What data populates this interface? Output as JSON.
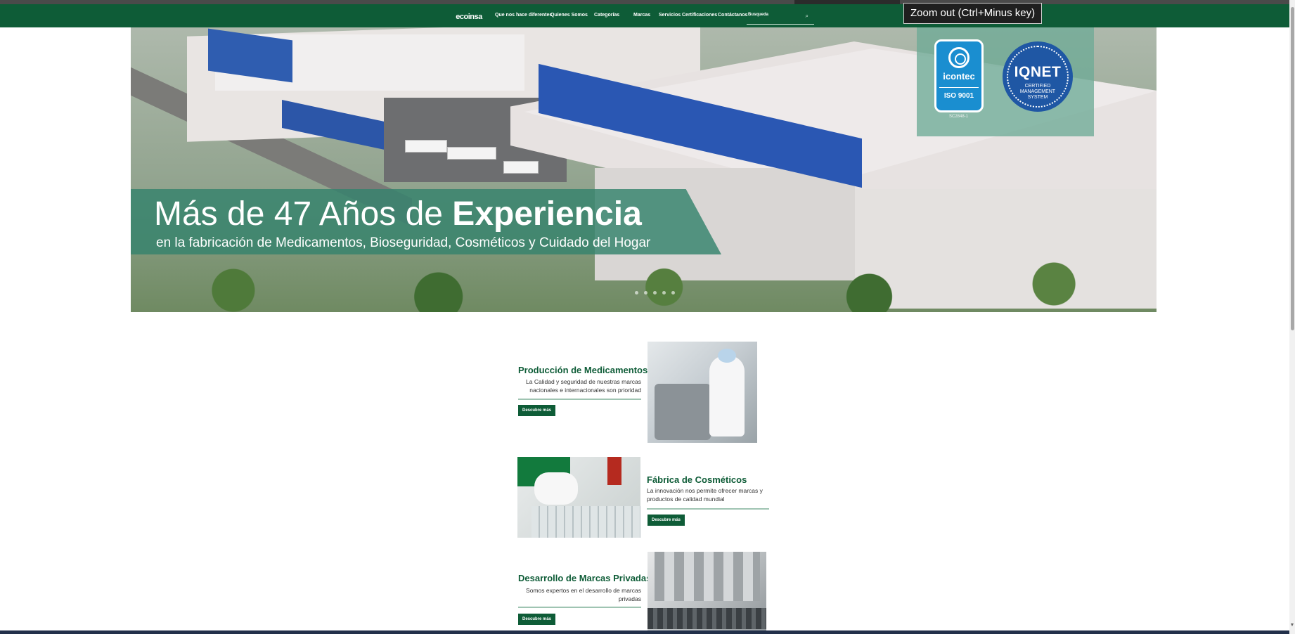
{
  "nav": {
    "logo": "ecoinsa",
    "links": [
      "Que nos hace diferentes",
      "Quienes Somos",
      "Categorías",
      "Marcas",
      "Servicios",
      "Certificaciones",
      "Contáctanos"
    ],
    "search_placeholder": "Busqueda",
    "background": "#0e5c37"
  },
  "tooltip": "Zoom out (Ctrl+Minus key)",
  "hero": {
    "title_regular": "Más de 47 Años de ",
    "title_bold": "Experiencia",
    "subtitle": "en la fabricación de Medicamentos, Bioseguridad, Cosméticos y Cuidado del Hogar",
    "certs": {
      "icontec_name": "icontec",
      "icontec_std": "ISO 9001",
      "icontec_code": "SC2848-1",
      "iqnet_name": "IQNET",
      "iqnet_sub": [
        "CERTIFIED",
        "MANAGEMENT",
        "SYSTEM"
      ]
    }
  },
  "services": [
    {
      "title": "Producción de Medicamentos",
      "desc": [
        "La Calidad y seguridad de nuestras marcas",
        "nacionales e internacionales son prioridad"
      ],
      "button": "Descubre más"
    },
    {
      "title": "Fábrica de Cosméticos",
      "desc": [
        "La innovación nos permite ofrecer ⁠marcas y",
        "productos de calidad mundial"
      ],
      "button": "Descubre más"
    },
    {
      "title": "Desarrollo de Marcas Privadas",
      "desc": [
        "Somos expertos en el desarrollo de marcas",
        "privadas"
      ],
      "button": "Descubre más"
    }
  ],
  "colors": {
    "brand_green": "#0e5c37",
    "accent_line": "#9fc4b2",
    "banner": "#34826c"
  }
}
